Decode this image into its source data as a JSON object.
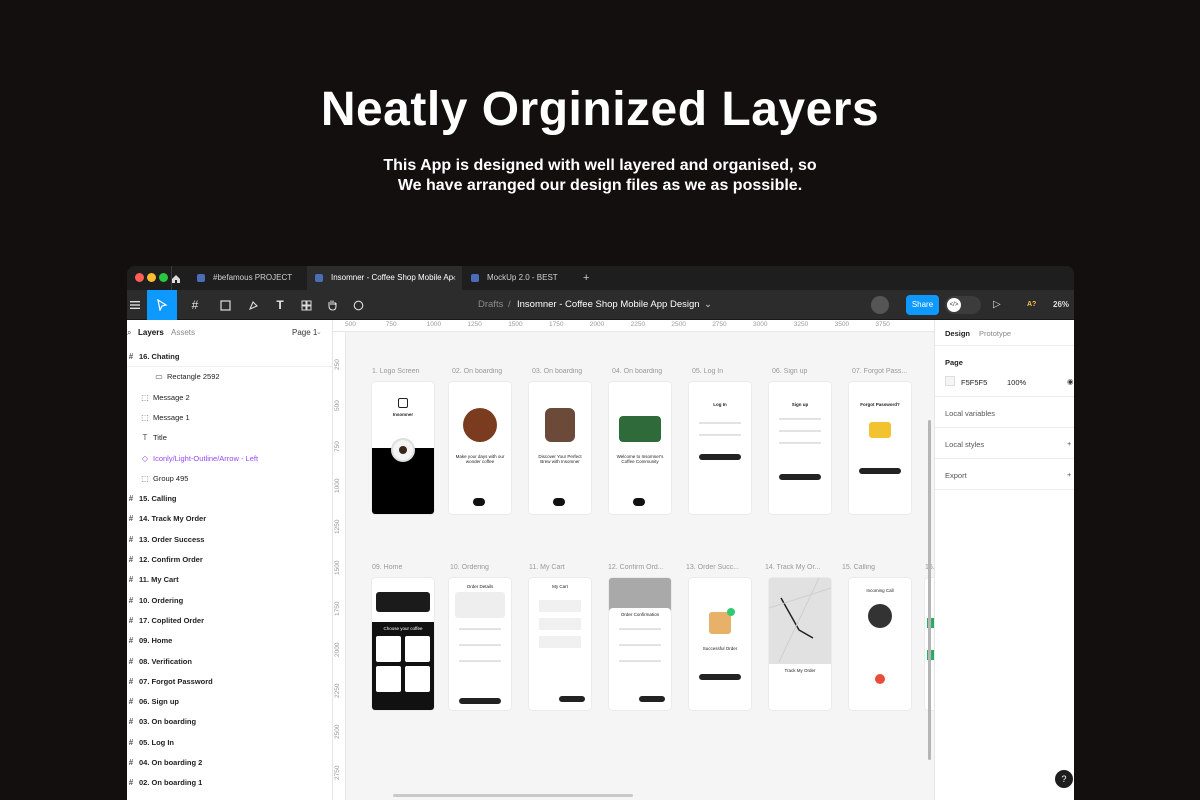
{
  "hero": {
    "title": "Neatly Orginized Layers",
    "subtitle_line1": "This App is designed with well layered and organised, so",
    "subtitle_line2": "We have arranged our design files as we as possible."
  },
  "tabs": [
    {
      "label": "#befamous PROJECT"
    },
    {
      "label": "Insomner - Coffee Shop Mobile Ap"
    },
    {
      "label": "MockUp 2.0 - BEST"
    }
  ],
  "tab_close": "×",
  "new_tab": "+",
  "toolbar": {
    "breadcrumb_root": "Drafts",
    "breadcrumb_sep": "/",
    "file_title": "Insomner - Coffee Shop Mobile App Design",
    "share_label": "Share",
    "zoom": "26%",
    "a_badge": "A?"
  },
  "layers_panel": {
    "tab_layers": "Layers",
    "tab_assets": "Assets",
    "page_selector": "Page 1",
    "items": [
      {
        "label": "16. Chating",
        "kind": "frame"
      },
      {
        "label": "Rectangle 2592",
        "kind": "rect"
      },
      {
        "label": "Message 2",
        "kind": "group"
      },
      {
        "label": "Message 1",
        "kind": "group"
      },
      {
        "label": "Title",
        "kind": "text"
      },
      {
        "label": "Iconly/Light-Outline/Arrow - Left",
        "kind": "component"
      },
      {
        "label": "Group 495",
        "kind": "group"
      },
      {
        "label": "15. Calling",
        "kind": "frame"
      },
      {
        "label": "14. Track My Order",
        "kind": "frame"
      },
      {
        "label": "13. Order Success",
        "kind": "frame"
      },
      {
        "label": "12. Confirm Order",
        "kind": "frame"
      },
      {
        "label": "11. My Cart",
        "kind": "frame"
      },
      {
        "label": "10. Ordering",
        "kind": "frame"
      },
      {
        "label": "17. Coplited Order",
        "kind": "frame"
      },
      {
        "label": "09. Home",
        "kind": "frame"
      },
      {
        "label": "08. Verification",
        "kind": "frame"
      },
      {
        "label": "07. Forgot Password",
        "kind": "frame"
      },
      {
        "label": "06. Sign up",
        "kind": "frame"
      },
      {
        "label": "03. On boarding",
        "kind": "frame"
      },
      {
        "label": "05. Log In",
        "kind": "frame"
      },
      {
        "label": "04. On boarding 2",
        "kind": "frame"
      },
      {
        "label": "02. On boarding 1",
        "kind": "frame"
      }
    ]
  },
  "ruler": {
    "top": [
      "500",
      "750",
      "1000",
      "1250",
      "1500",
      "1750",
      "2000",
      "2250",
      "2500",
      "2750",
      "3000",
      "3250",
      "3500",
      "3750"
    ],
    "left": [
      "250",
      "500",
      "750",
      "1000",
      "1250",
      "1500",
      "1750",
      "2000",
      "2250",
      "2500",
      "2750"
    ]
  },
  "frames": {
    "row1": [
      {
        "label": "1. Logo Screen"
      },
      {
        "label": "02. On boarding"
      },
      {
        "label": "03. On boarding"
      },
      {
        "label": "04. On boarding"
      },
      {
        "label": "05. Log In"
      },
      {
        "label": "06. Sign up"
      },
      {
        "label": "07. Forgot Pass..."
      }
    ],
    "row2": [
      {
        "label": "09. Home"
      },
      {
        "label": "10. Ordering"
      },
      {
        "label": "11. My Cart"
      },
      {
        "label": "12. Confirm Ord..."
      },
      {
        "label": "13. Order Succ..."
      },
      {
        "label": "14. Track My Or..."
      },
      {
        "label": "15. Calling"
      },
      {
        "label": "16. Cl"
      }
    ],
    "inner_text": {
      "logo": "Insomner",
      "onb1": "Make your days with our wonder coffee",
      "onb2": "Discover Your Perfect Brew with Insomner",
      "onb3": "Welcome to Insomner's Coffee Community",
      "login": "Log In",
      "signup": "Sign up",
      "forgot": "Forgot Password?",
      "next": "Next",
      "reset": "Reset",
      "cart": "My Cart",
      "confirm": "Order Confirmation",
      "success": "Successful Order",
      "track": "Track My Order",
      "calling": "Incoming Call",
      "home_choose": "Choose your coffee",
      "ordering": "Order Details"
    }
  },
  "right_panel": {
    "tab_design": "Design",
    "tab_prototype": "Prototype",
    "page_heading": "Page",
    "page_color": "F5F5F5",
    "page_opacity": "100%",
    "local_variables": "Local variables",
    "local_styles": "Local styles",
    "export": "Export"
  },
  "help": "?"
}
